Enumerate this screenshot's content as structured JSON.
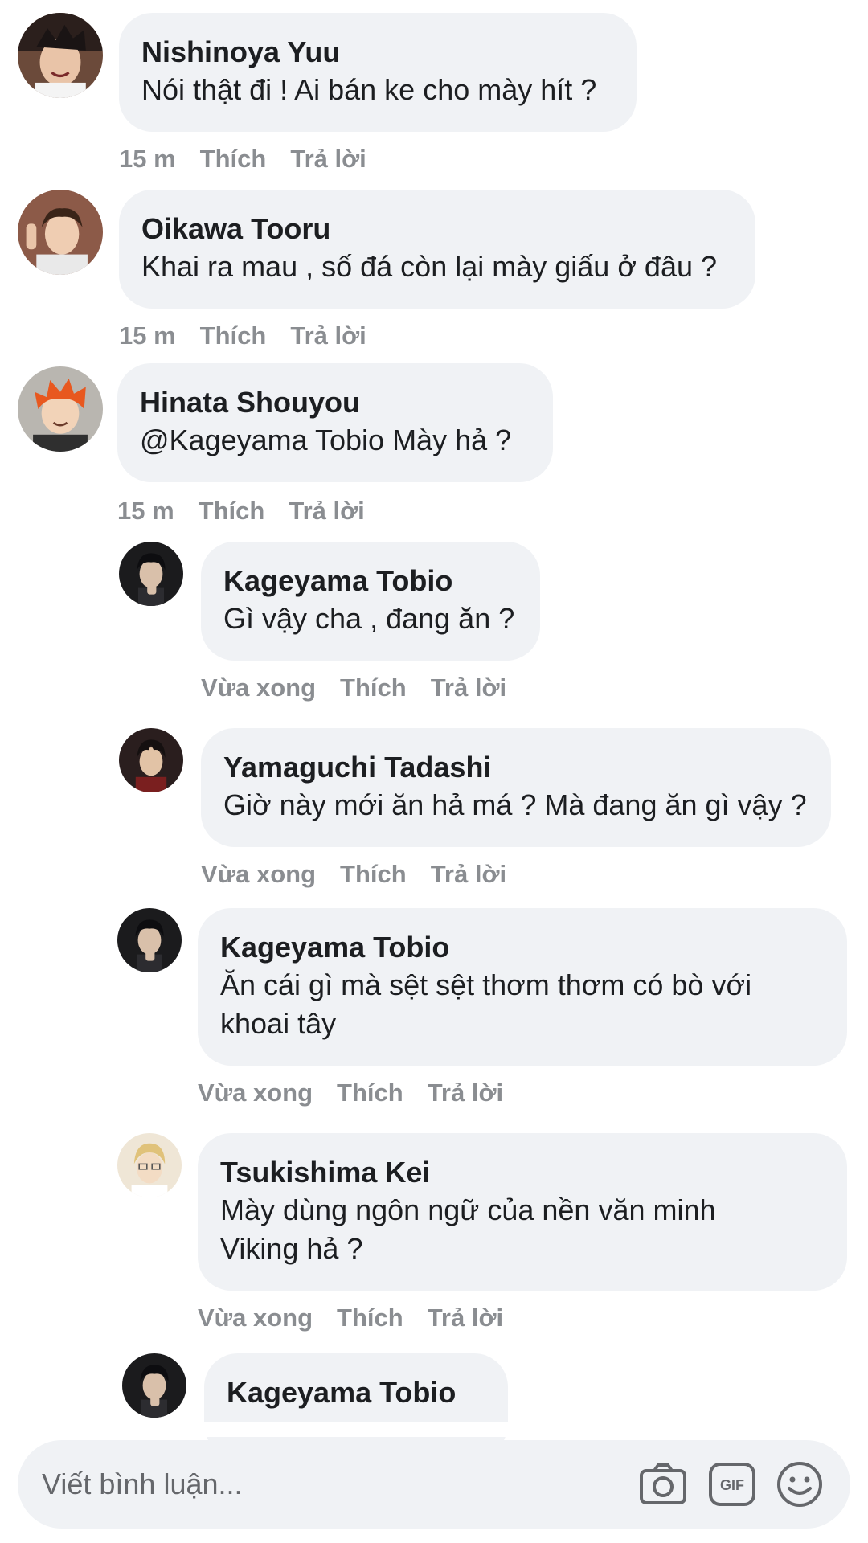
{
  "comments": [
    {
      "name": "Nishinoya Yuu",
      "text": "Nói thật đi ! Ai bán ke cho mày hít ?",
      "time": "15 m",
      "like": "Thích",
      "reply": "Trả lời"
    },
    {
      "name": "Oikawa Tooru",
      "text": "Khai ra mau , số đá còn lại mày giấu ở đâu ?",
      "time": "15 m",
      "like": "Thích",
      "reply": "Trả lời"
    },
    {
      "name": "Hinata Shouyou",
      "text": "@Kageyama Tobio Mày hả ?",
      "time": "15 m",
      "like": "Thích",
      "reply": "Trả lời"
    },
    {
      "name": "Kageyama Tobio",
      "text": "Gì vậy cha , đang ăn ?",
      "time": "Vừa xong",
      "like": "Thích",
      "reply": "Trả lời"
    },
    {
      "name": "Yamaguchi Tadashi",
      "text": "Giờ này mới ăn hả má ? Mà đang ăn gì vậy ?",
      "time": "Vừa xong",
      "like": "Thích",
      "reply": "Trả lời"
    },
    {
      "name": "Kageyama Tobio",
      "text": "Ăn cái gì mà sệt sệt thơm thơm có bò với khoai tây",
      "time": "Vừa xong",
      "like": "Thích",
      "reply": "Trả lời"
    },
    {
      "name": "Tsukishima Kei",
      "text": "Mày dùng ngôn ngữ của nền văn minh Viking hả ?",
      "time": "Vừa xong",
      "like": "Thích",
      "reply": "Trả lời"
    },
    {
      "name": "Kageyama Tobio"
    }
  ],
  "composer": {
    "placeholder": "Viết bình luận...",
    "icons": [
      "camera-icon",
      "gif-icon",
      "emoji-icon"
    ],
    "gif_label": "GIF"
  },
  "colors": {
    "bubble": "#f0f2f5",
    "meta": "#8a8d91",
    "text": "#1c1e21"
  }
}
